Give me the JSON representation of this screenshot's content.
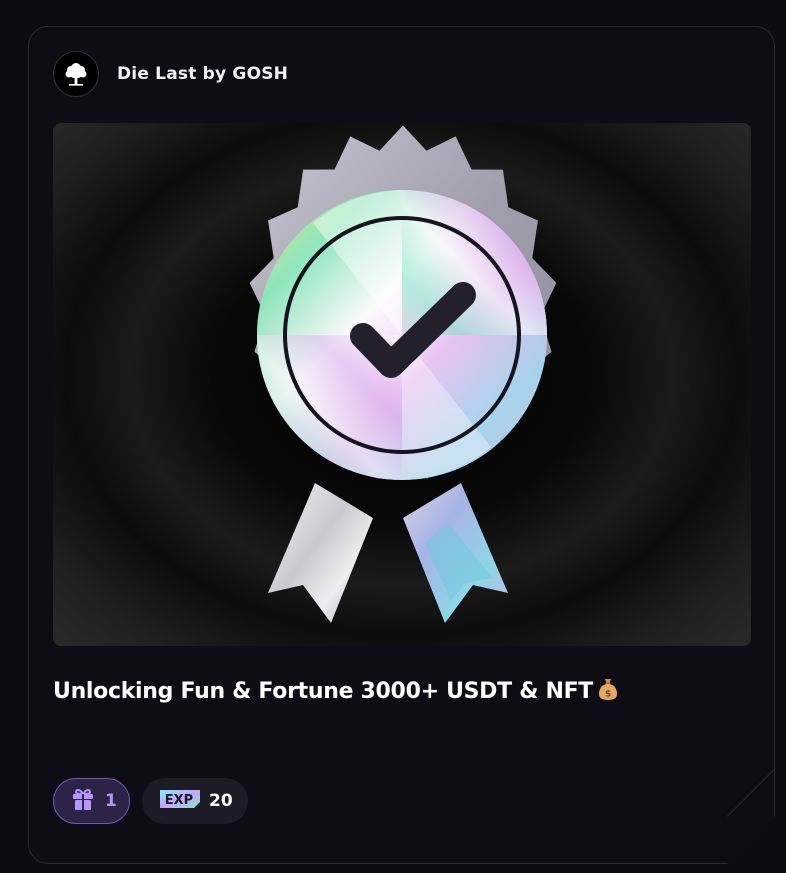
{
  "card": {
    "brand_name": "Die Last by GOSH",
    "avatar_icon": "tree-icon",
    "banner_icon": "verified-badge-icon",
    "title": "Unlocking Fun & Fortune 3000+ USDT & NFT",
    "title_emoji_icon": "money-bag-icon",
    "rewards": {
      "gift_icon": "gift-icon",
      "gift_count": "1",
      "exp_icon": "exp-icon",
      "exp_label": "EXP",
      "exp_value": "20"
    }
  },
  "colors": {
    "background": "#0d0c15",
    "card_border": "#2a2935",
    "gift_pill_bg": "#2d2347",
    "gift_pill_border": "#6f56b8",
    "gift_accent": "#b596ff",
    "exp_pill_bg": "#1c1b26"
  }
}
